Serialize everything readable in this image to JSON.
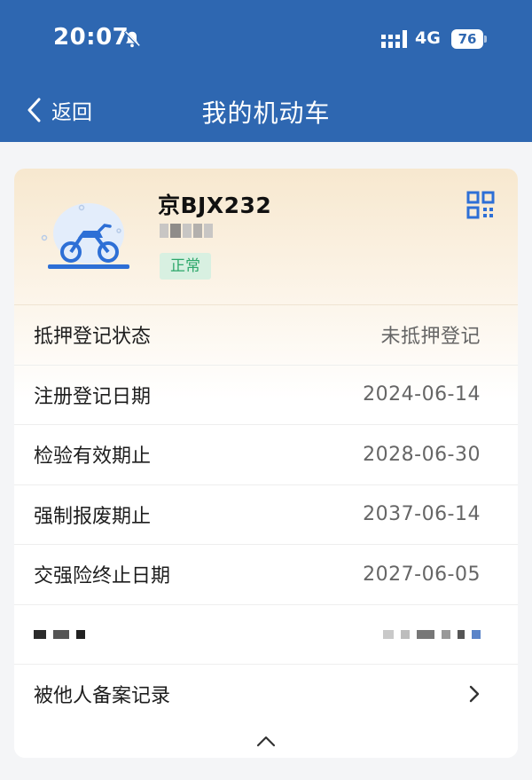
{
  "status_bar": {
    "time": "20:07",
    "network": "4G",
    "battery": "76"
  },
  "header": {
    "back_label": "返回",
    "title": "我的机动车"
  },
  "vehicle": {
    "plate": "京BJX232",
    "status": "正常"
  },
  "details": [
    {
      "label": "抵押登记状态",
      "value": "未抵押登记"
    },
    {
      "label": "注册登记日期",
      "value": "2024-06-14"
    },
    {
      "label": "检验有效期止",
      "value": "2028-06-30"
    },
    {
      "label": "强制报废期止",
      "value": "2037-06-14"
    },
    {
      "label": "交强险终止日期",
      "value": "2027-06-05"
    }
  ],
  "record_link": {
    "label": "被他人备案记录"
  },
  "colors": {
    "header_bg": "#2e67b1",
    "accent_blue": "#2d6fd6",
    "status_green": "#2da76a",
    "status_green_bg": "#d8f0e1"
  }
}
